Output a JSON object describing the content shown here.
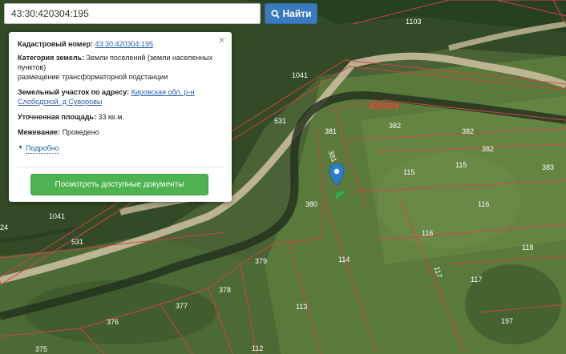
{
  "search": {
    "value": "43:30:420304:195",
    "button_label": "Найти"
  },
  "popup": {
    "cadastral_label": "Кадастровый номер:",
    "cadastral_value": "43:30:420304:195",
    "category_label": "Категория земель:",
    "category_value": "Земли поселений (земли населенных пунктов)",
    "usage_value": "размещение трансформаторной подстанции",
    "address_label": "Земельный участок по адресу:",
    "address_value": "Кировская обл, р-н Слободской, д Суворовы",
    "area_label": "Уточненная площадь:",
    "area_value": "33 кв.м.",
    "survey_label": "Межевание:",
    "survey_value": "Проведено",
    "details_label": "Подробно",
    "docs_button_label": "Посмотреть доступные документы",
    "close_glyph": "×"
  },
  "map": {
    "quarter_label": "420304",
    "parcel_labels": [
      "1103",
      "1041",
      "531",
      "381",
      "381",
      "382",
      "382",
      "382",
      "115",
      "115",
      "383",
      "380",
      "116",
      "116",
      "118",
      "1041",
      "531",
      "379",
      "114",
      "117",
      "117",
      "378",
      "377",
      "113",
      "376",
      "197",
      "375",
      "112",
      "24"
    ],
    "border_color": "#d4424a",
    "road_color": "#c9bd9c",
    "marker_color": "#2f7ccb"
  }
}
